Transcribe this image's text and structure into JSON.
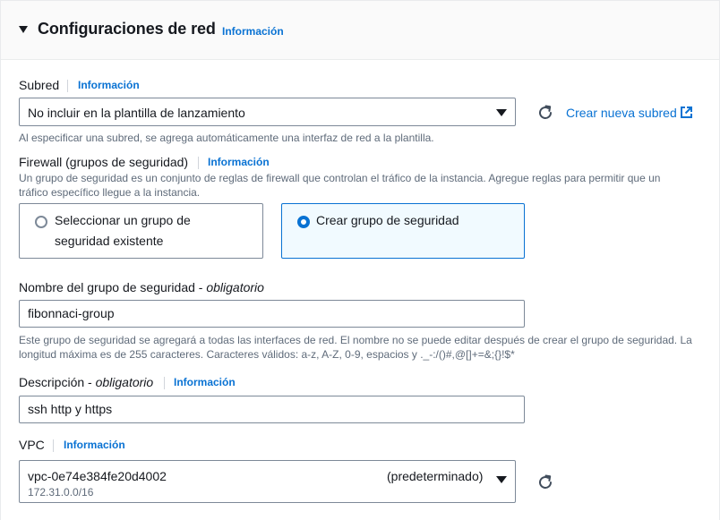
{
  "section": {
    "title": "Configuraciones de red",
    "info": "Información"
  },
  "subnet": {
    "label": "Subred",
    "info": "Información",
    "value": "No incluir en la plantilla de lanzamiento",
    "create_link": "Crear nueva subred",
    "help": "Al especificar una subred, se agrega automáticamente una interfaz de red a la plantilla."
  },
  "firewall": {
    "label": "Firewall (grupos de seguridad)",
    "info": "Información",
    "help_line1": "Un grupo de seguridad es un conjunto de reglas de firewall que controlan el tráfico de la instancia. Agregue reglas para permitir que un",
    "help_line2": "tráfico específico llegue a la instancia.",
    "options": [
      {
        "line1": "Seleccionar un grupo de",
        "line2": "seguridad existente",
        "selected": false
      },
      {
        "line1": "Crear grupo de seguridad",
        "selected": true
      }
    ]
  },
  "sg_name": {
    "label": "Nombre del grupo de seguridad - ",
    "required": "obligatorio",
    "value": "fibonnaci-group",
    "help_line1": "Este grupo de seguridad se agregará a todas las interfaces de red. El nombre no se puede editar después de crear el grupo de seguridad. La",
    "help_line2": "longitud máxima es de 255 caracteres. Caracteres válidos: a-z, A-Z, 0-9, espacios y ._-:/()#,@[]+=&;{}!$*"
  },
  "description": {
    "label": "Descripción - ",
    "required": "obligatorio",
    "info": "Información",
    "value": "ssh http y https"
  },
  "vpc": {
    "label": "VPC",
    "info": "Información",
    "value": "vpc-0e74e384fe20d4002",
    "tag": "(predeterminado)",
    "cidr": "172.31.0.0/16"
  },
  "colors": {
    "link": "#0972d3",
    "text": "#16191f",
    "muted": "#5f6b7a",
    "border": "#7d8998",
    "selected_bg": "#f1faff"
  }
}
